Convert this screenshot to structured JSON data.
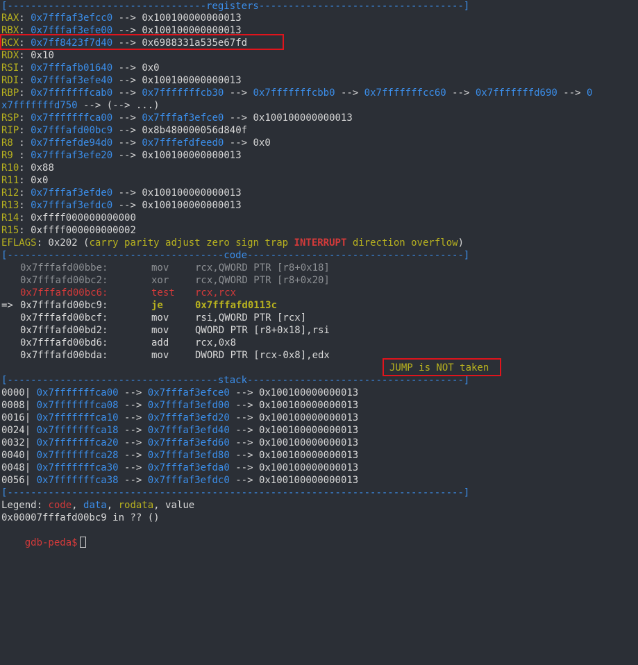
{
  "window": {
    "background": "#2b2f36",
    "prompt_color": "#d33a3a",
    "highlight_box_color": "#e0141c"
  },
  "separators": {
    "registers": "[----------------------------------registers-----------------------------------]",
    "code": "[-------------------------------------code-------------------------------------]",
    "stack": "[------------------------------------stack-------------------------------------]",
    "end": "[------------------------------------------------------------------------------]"
  },
  "arrow": "-->",
  "registers": [
    {
      "name": "RAX",
      "parts": [
        [
          "b",
          "0x7fffaf3efcc0"
        ],
        [
          "w",
          "0x100100000000013"
        ]
      ]
    },
    {
      "name": "RBX",
      "parts": [
        [
          "b",
          "0x7fffaf3efe00"
        ],
        [
          "w",
          "0x100100000000013"
        ]
      ]
    },
    {
      "name": "RCX",
      "parts": [
        [
          "b",
          "0x7ff8423f7d40"
        ],
        [
          "w",
          "0x6988331a535e67fd"
        ]
      ]
    },
    {
      "name": "RDX",
      "parts": [
        [
          "w",
          "0x10"
        ]
      ]
    },
    {
      "name": "RSI",
      "parts": [
        [
          "b",
          "0x7fffafb01640"
        ],
        [
          "w",
          "0x0"
        ]
      ]
    },
    {
      "name": "RDI",
      "parts": [
        [
          "b",
          "0x7fffaf3efe40"
        ],
        [
          "w",
          "0x100100000000013"
        ]
      ]
    },
    {
      "name": "RBP",
      "parts": [
        [
          "b",
          "0x7fffffffcab0"
        ],
        [
          "b",
          "0x7fffffffcb30"
        ],
        [
          "b",
          "0x7fffffffcbb0"
        ],
        [
          "b",
          "0x7fffffffcc60"
        ],
        [
          "b",
          "0x7fffffffd690"
        ],
        [
          "b",
          "0"
        ]
      ]
    },
    {
      "name": "",
      "parts": [
        [
          "b",
          "x7fffffffd750"
        ],
        [
          "w",
          "(--> ...)"
        ]
      ],
      "continuation": true
    },
    {
      "name": "RSP",
      "parts": [
        [
          "b",
          "0x7fffffffca00"
        ],
        [
          "b",
          "0x7fffaf3efce0"
        ],
        [
          "w",
          "0x100100000000013"
        ]
      ]
    },
    {
      "name": "RIP",
      "parts": [
        [
          "b",
          "0x7fffafd00bc9"
        ],
        [
          "w",
          "0x8b480000056d840f"
        ]
      ]
    },
    {
      "name": "R8 ",
      "parts": [
        [
          "b",
          "0x7fffefde94d0"
        ],
        [
          "b",
          "0x7fffefdfeed0"
        ],
        [
          "w",
          "0x0"
        ]
      ]
    },
    {
      "name": "R9 ",
      "parts": [
        [
          "b",
          "0x7fffaf3efe20"
        ],
        [
          "w",
          "0x100100000000013"
        ]
      ]
    },
    {
      "name": "R10",
      "parts": [
        [
          "w",
          "0x88"
        ]
      ]
    },
    {
      "name": "R11",
      "parts": [
        [
          "w",
          "0x0"
        ]
      ]
    },
    {
      "name": "R12",
      "parts": [
        [
          "b",
          "0x7fffaf3efde0"
        ],
        [
          "w",
          "0x100100000000013"
        ]
      ]
    },
    {
      "name": "R13",
      "parts": [
        [
          "b",
          "0x7fffaf3efdc0"
        ],
        [
          "w",
          "0x100100000000013"
        ]
      ]
    },
    {
      "name": "R14",
      "parts": [
        [
          "w",
          "0xffff000000000000"
        ]
      ]
    },
    {
      "name": "R15",
      "parts": [
        [
          "w",
          "0xffff000000000002"
        ]
      ]
    }
  ],
  "eflags": {
    "label": "EFLAGS",
    "value": "0x202",
    "flags": [
      "carry",
      "parity",
      "adjust",
      "zero",
      "sign",
      "trap",
      "INTERRUPT",
      "direction",
      "overflow"
    ],
    "set_flag": "INTERRUPT"
  },
  "code": [
    {
      "marker": "",
      "addr": "0x7fffafd00bbe:",
      "mnem": "mov",
      "ops": "rcx,QWORD PTR [r8+0x18]",
      "style": "grey"
    },
    {
      "marker": "",
      "addr": "0x7fffafd00bc2:",
      "mnem": "xor",
      "ops": "rcx,QWORD PTR [r8+0x20]",
      "style": "grey"
    },
    {
      "marker": "",
      "addr": "0x7fffafd00bc6:",
      "mnem": "test",
      "ops": "rcx,rcx",
      "style": "red"
    },
    {
      "marker": "=>",
      "addr": "0x7fffafd00bc9:",
      "mnem": "je",
      "ops": "0x7fffafd0113c",
      "style": "current"
    },
    {
      "marker": "",
      "addr": "0x7fffafd00bcf:",
      "mnem": "mov",
      "ops": "rsi,QWORD PTR [rcx]",
      "style": "white"
    },
    {
      "marker": "",
      "addr": "0x7fffafd00bd2:",
      "mnem": "mov",
      "ops": "QWORD PTR [r8+0x18],rsi",
      "style": "white"
    },
    {
      "marker": "",
      "addr": "0x7fffafd00bd6:",
      "mnem": "add",
      "ops": "rcx,0x8",
      "style": "white"
    },
    {
      "marker": "",
      "addr": "0x7fffafd00bda:",
      "mnem": "mov",
      "ops": "DWORD PTR [rcx-0x8],edx",
      "style": "white"
    }
  ],
  "jump_status": "JUMP is NOT taken",
  "stack": [
    {
      "off": "0000|",
      "a": "0x7fffffffca00",
      "b": "0x7fffaf3efce0",
      "c": "0x100100000000013"
    },
    {
      "off": "0008|",
      "a": "0x7fffffffca08",
      "b": "0x7fffaf3efd00",
      "c": "0x100100000000013"
    },
    {
      "off": "0016|",
      "a": "0x7fffffffca10",
      "b": "0x7fffaf3efd20",
      "c": "0x100100000000013"
    },
    {
      "off": "0024|",
      "a": "0x7fffffffca18",
      "b": "0x7fffaf3efd40",
      "c": "0x100100000000013"
    },
    {
      "off": "0032|",
      "a": "0x7fffffffca20",
      "b": "0x7fffaf3efd60",
      "c": "0x100100000000013"
    },
    {
      "off": "0040|",
      "a": "0x7fffffffca28",
      "b": "0x7fffaf3efd80",
      "c": "0x100100000000013"
    },
    {
      "off": "0048|",
      "a": "0x7fffffffca30",
      "b": "0x7fffaf3efda0",
      "c": "0x100100000000013"
    },
    {
      "off": "0056|",
      "a": "0x7fffffffca38",
      "b": "0x7fffaf3efdc0",
      "c": "0x100100000000013"
    }
  ],
  "legend": {
    "label": "Legend:",
    "items": [
      {
        "text": "code",
        "color": "#d33a3a"
      },
      {
        "text": "data",
        "color": "#3b8eea"
      },
      {
        "text": "rodata",
        "color": "#b8b21f"
      },
      {
        "text": "value",
        "color": "#d8d8d8"
      }
    ]
  },
  "location_line": "0x00007fffafd00bc9 in ?? ()",
  "prompt": "gdb-peda$"
}
